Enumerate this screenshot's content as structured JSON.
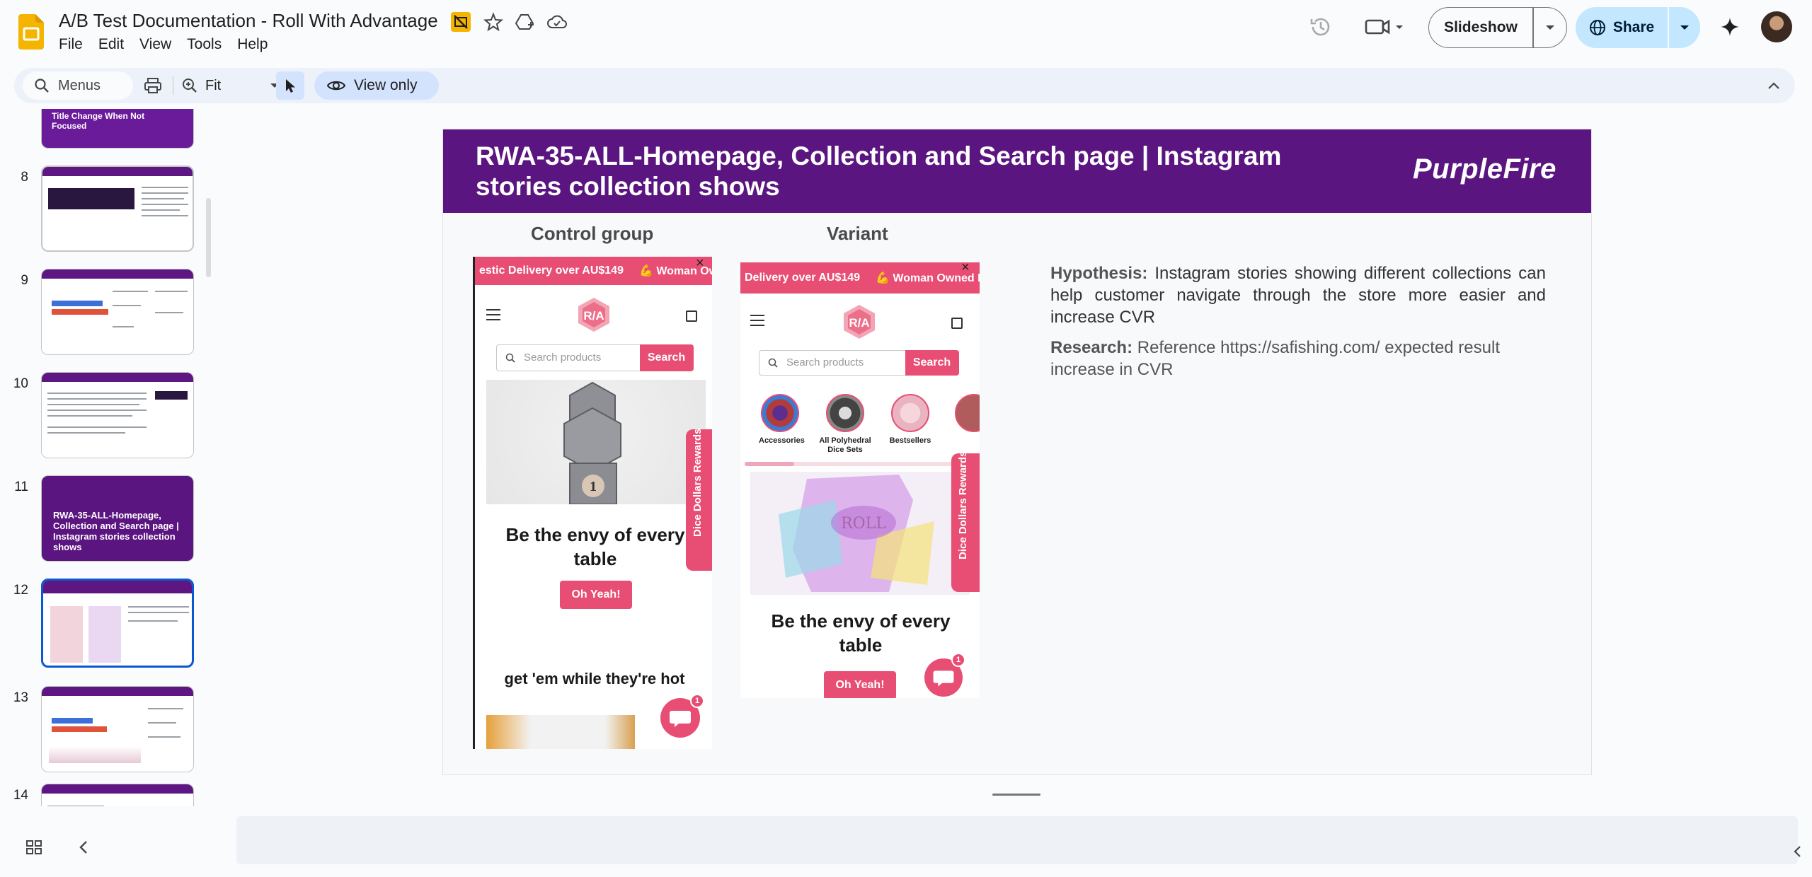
{
  "app": {
    "doc_title": "A/B Test Documentation - Roll With Advantage",
    "menu": [
      "File",
      "Edit",
      "View",
      "Tools",
      "Help"
    ],
    "icons": [
      "slides-logo-icon",
      "star-icon",
      "move-to-drive-icon",
      "cloud-saved-icon",
      "history-icon",
      "meet-icon",
      "gemini-icon"
    ]
  },
  "header": {
    "slideshow_label": "Slideshow",
    "share_label": "Share"
  },
  "toolbar": {
    "menus_search": "Menus",
    "zoom_label": "Fit",
    "view_only_label": "View only"
  },
  "filmstrip": {
    "partial_top_title": "Title Change When Not Focused",
    "slide_numbers": [
      "8",
      "9",
      "10",
      "11",
      "12",
      "13",
      "14"
    ],
    "slide_11_title": "RWA-35-ALL-Homepage, Collection and Search page | Instagram stories collection shows",
    "selected": "12"
  },
  "slide": {
    "title": "RWA-35-ALL-Homepage, Collection and Search page | Instagram stories collection shows",
    "brand": "PurpleFire",
    "control_label": "Control group",
    "variant_label": "Variant",
    "control_phone": {
      "promo": [
        "estic Delivery over AU$149",
        "💪 Woman Owned"
      ],
      "search_placeholder": "Search products",
      "search_button": "Search",
      "headline": "Be the envy of every table",
      "cta": "Oh Yeah!",
      "subheadline": "get 'em while they're hot",
      "rewards": "Dice Dollars Rewards",
      "chat_badge": "1"
    },
    "variant_phone": {
      "promo": [
        "Delivery over AU$149",
        "💪 Woman Owned Fam"
      ],
      "search_placeholder": "Search products",
      "search_button": "Search",
      "stories": [
        "Accessories",
        "All Polyhedral Dice Sets",
        "Bestsellers"
      ],
      "headline": "Be the envy of every table",
      "cta": "Oh Yeah!",
      "rewards": "Dice Dollars Rewards",
      "chat_badge": "1"
    },
    "hypothesis_label": "Hypothesis:",
    "hypothesis_text": " Instagram stories showing different collections can help customer navigate through the store more easier and increase CVR",
    "research_label": "Research:",
    "research_text": " Reference https://safishing.com/ expected result increase in CVR"
  },
  "colors": {
    "banner": "#5b1580",
    "brand_pink": "#e84d73",
    "share_bg": "#c2e7ff",
    "selected_thumb": "#0b57d0"
  }
}
